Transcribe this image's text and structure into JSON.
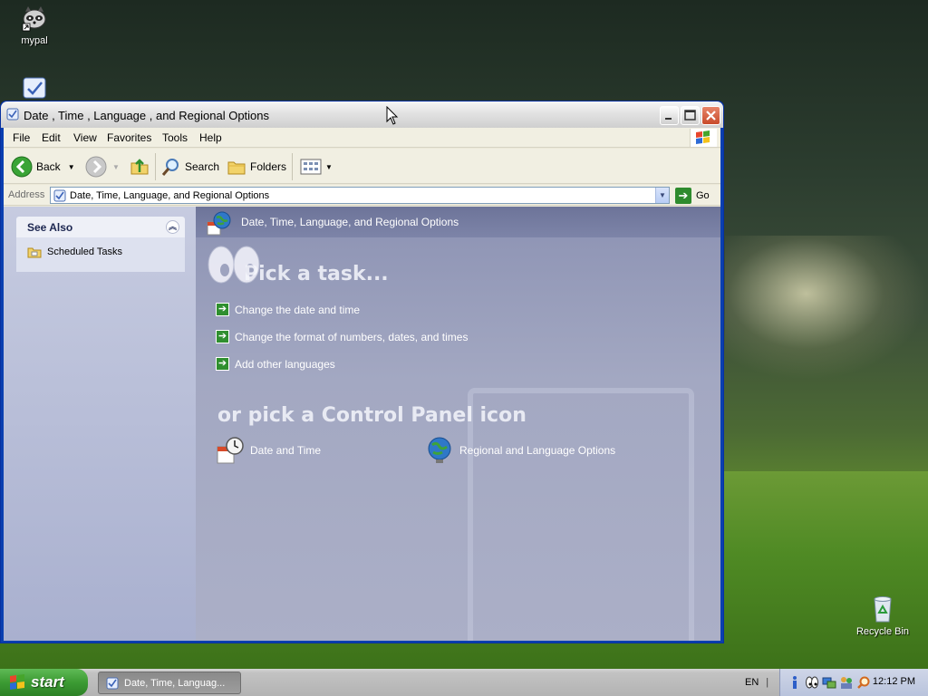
{
  "desktop": {
    "icons": [
      {
        "label": "mypal",
        "icon": "raccoon-icon"
      },
      {
        "label": "",
        "icon": "control-panel-shortcut-icon"
      },
      {
        "label": "Recycle Bin",
        "icon": "recycle-bin-icon"
      }
    ]
  },
  "window": {
    "title": "Date , Time , Language , and Regional Options",
    "menu": [
      "File",
      "Edit",
      "View",
      "Favorites",
      "Tools",
      "Help"
    ],
    "toolbar": {
      "back": "Back",
      "search": "Search",
      "folders": "Folders"
    },
    "address": {
      "label": "Address",
      "value": "Date, Time, Language, and Regional Options",
      "go": "Go"
    },
    "see_also": {
      "title": "See Also",
      "items": [
        "Scheduled Tasks"
      ]
    },
    "main": {
      "header": "Date, Time, Language, and Regional Options",
      "pick_task": "Pick a task...",
      "tasks": [
        "Change the date and time",
        "Change the format of numbers, dates, and times",
        "Add other languages"
      ],
      "or_pick": "or pick a Control Panel icon",
      "icons": [
        "Date and Time",
        "Regional and Language Options"
      ]
    }
  },
  "taskbar": {
    "start": "start",
    "task_button": "Date, Time, Languag...",
    "language": "EN",
    "clock": "12:12 PM"
  }
}
